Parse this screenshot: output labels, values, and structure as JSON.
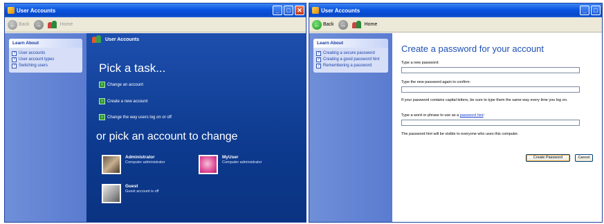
{
  "window_left": {
    "title": "User Accounts",
    "toolbar": {
      "back": "Back",
      "home": "Home"
    },
    "learn_about": {
      "header": "Learn About",
      "items": [
        "User accounts",
        "User account types",
        "Switching users"
      ]
    },
    "header": "User Accounts",
    "pick_task": "Pick a task...",
    "tasks": [
      "Change an account",
      "Create a new account",
      "Change the way users log on or off"
    ],
    "pick_account": "or pick an account to change",
    "accounts": [
      {
        "name": "Administrator",
        "role": "Computer administrator"
      },
      {
        "name": "MyUser",
        "role": "Computer administrator"
      },
      {
        "name": "Guest",
        "role": "Guest account is off"
      }
    ]
  },
  "window_right": {
    "title": "User Accounts",
    "toolbar": {
      "back": "Back",
      "home": "Home"
    },
    "learn_about": {
      "header": "Learn About",
      "items": [
        "Creating a secure password",
        "Creating a good password hint",
        "Remembering a password"
      ]
    },
    "heading": "Create a password for your account",
    "fields": {
      "new_password_label": "Type a new password:",
      "confirm_label": "Type the new password again to confirm:",
      "caps_note": "If your password contains capital letters, be sure to type them the same way every time you log on.",
      "hint_label_prefix": "Type a word or phrase to use as a ",
      "hint_link": "password hint",
      "hint_label_suffix": ":",
      "hint_note": "The password hint will be visible to everyone who uses this computer."
    },
    "buttons": {
      "create": "Create Password",
      "cancel": "Cancel"
    }
  },
  "colors": {
    "xp_title_blue": "#0a55e0",
    "panel_blue": "#0d3a8e",
    "heading_blue": "#1c4fb4"
  }
}
